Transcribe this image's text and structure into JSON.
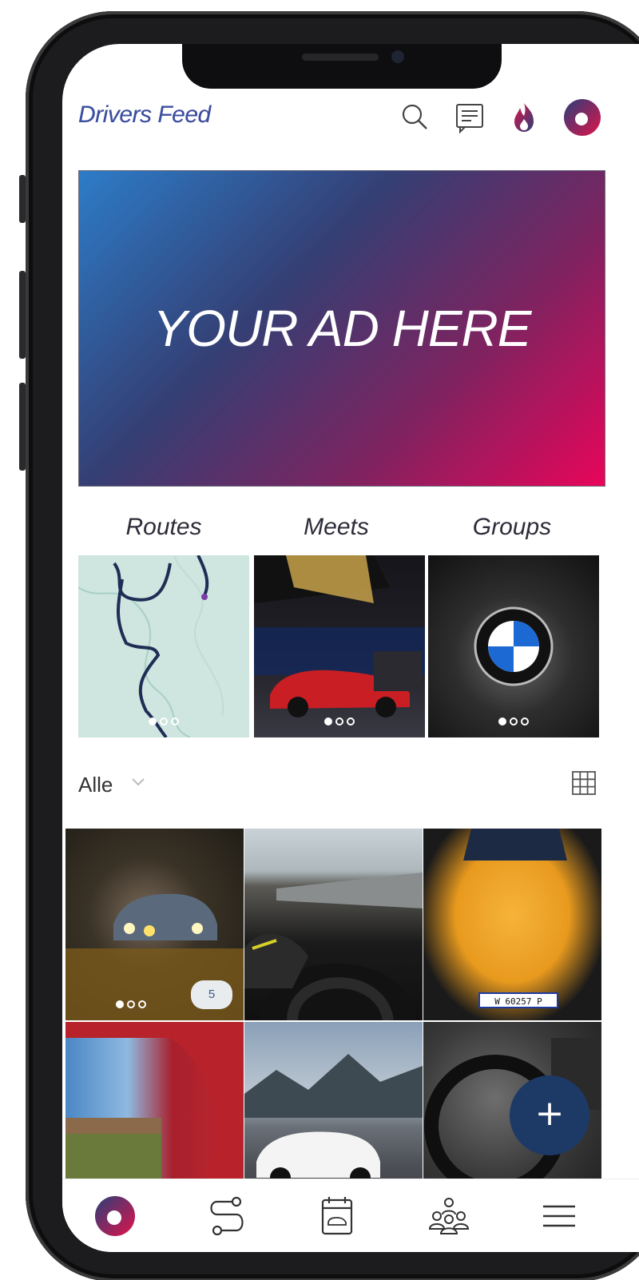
{
  "header": {
    "title": "Drivers Feed",
    "icons": [
      "search-icon",
      "messages-icon",
      "flame-icon",
      "profile-logo-icon"
    ]
  },
  "ad": {
    "text": "YOUR AD HERE"
  },
  "categories": [
    {
      "label": "Routes",
      "image": "route-map"
    },
    {
      "label": "Meets",
      "image": "swiss-classic-award-car"
    },
    {
      "label": "Groups",
      "image": "bmw-logo"
    }
  ],
  "filter": {
    "value": "Alle"
  },
  "feed": {
    "tiles": [
      {
        "image": "classic-car-night-headlights",
        "badge": "5"
      },
      {
        "image": "driving-honda-steering-wheel"
      },
      {
        "image": "yellow-honda-s2000",
        "plate": "W 60257 P"
      },
      {
        "image": "red-car-window-view"
      },
      {
        "image": "white-honda-civic-mountains"
      },
      {
        "image": "steering-wheel-interior"
      }
    ],
    "fab_label": "+"
  },
  "nav": {
    "items": [
      "home-logo-icon",
      "routes-icon",
      "events-icon",
      "groups-icon",
      "menu-icon"
    ]
  },
  "colors": {
    "brand_blue": "#1d3a67",
    "brand_pink": "#e8055a",
    "title_gradient": [
      "#2f5aa6",
      "#8a2a6b"
    ]
  }
}
